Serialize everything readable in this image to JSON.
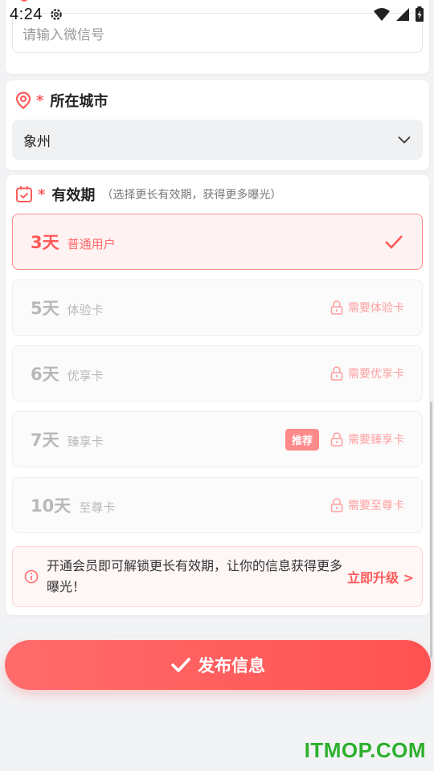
{
  "status_bar": {
    "time": "4:24"
  },
  "wechat": {
    "placeholder": "请输入微信号"
  },
  "city": {
    "required_mark": "*",
    "label": "所在城市",
    "value": "象州"
  },
  "validity": {
    "required_mark": "*",
    "label": "有效期",
    "hint": "（选择更长有效期，获得更多曝光）",
    "options": [
      {
        "days": "3天",
        "tier": "普通用户",
        "selected": true
      },
      {
        "days": "5天",
        "tier": "体验卡",
        "lock_text": "需要体验卡"
      },
      {
        "days": "6天",
        "tier": "优享卡",
        "lock_text": "需要优享卡"
      },
      {
        "days": "7天",
        "tier": "臻享卡",
        "badge": "推荐",
        "lock_text": "需要臻享卡"
      },
      {
        "days": "10天",
        "tier": "至尊卡",
        "lock_text": "需要至尊卡"
      }
    ],
    "upgrade_message": "开通会员即可解锁更长有效期，让你的信息获得更多曝光！",
    "upgrade_cta": "立即升级 >"
  },
  "publish_button": {
    "label": "发布信息"
  },
  "watermark": "ITMOP.COM",
  "colors": {
    "accent": "#ff5a5a",
    "lock": "#ffa0a0",
    "watermark": "#2db02d"
  }
}
